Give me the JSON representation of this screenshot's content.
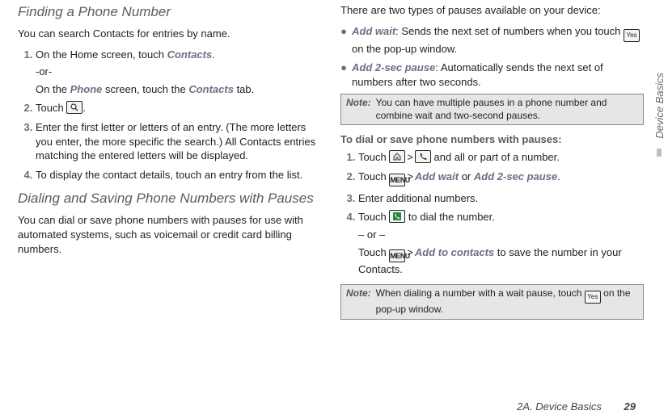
{
  "left": {
    "h_find": "Finding a Phone Number",
    "find_intro": "You can search Contacts for entries by name.",
    "find_steps": [
      {
        "text": "On the Home screen, touch ",
        "bold1": "Contacts",
        "tail": ".",
        "sub1": "-or-",
        "sub2a": "On the ",
        "sub2b": "Phone",
        "sub2c": " screen, touch the ",
        "sub2d": "Contacts",
        "sub2e": " tab."
      },
      {
        "text": "Touch ",
        "icon": "search",
        "tail": "."
      },
      {
        "text": "Enter the first letter or letters of an entry. (The more letters you enter, the more specific the search.) All Contacts entries matching the entered letters will be displayed."
      },
      {
        "text": "To display the contact details, touch an entry from the list."
      }
    ],
    "h_dial": "Dialing and Saving Phone Numbers with Pauses",
    "dial_intro": "You can dial or save phone numbers with pauses for use with automated systems, such as voicemail or credit card billing numbers."
  },
  "right": {
    "pauses_intro": "There are two types of pauses available on your device:",
    "bullets": [
      {
        "b": "Add wait",
        "rest": ": Sends the next set of numbers when you touch ",
        "icon": "yes",
        "tail": " on the pop-up window."
      },
      {
        "b": "Add 2-sec pause",
        "rest": ": Automatically sends the next set of numbers after two seconds."
      }
    ],
    "note1_label": "Note:",
    "note1": "You can have multiple pauses in a phone number and combine wait and two-second pauses.",
    "subhead": "To dial or save phone numbers with pauses:",
    "steps": [
      {
        "pre": "Touch ",
        "icon1": "home",
        "gt": ">",
        "icon2": "phone",
        "post": " and all or part of a number."
      },
      {
        "pre": "Touch ",
        "icon1": "menu",
        "gt": ">",
        "b1": "Add wait",
        "mid": " or ",
        "b2": "Add 2-sec pause",
        "post": "."
      },
      {
        "pre": "Enter additional numbers."
      },
      {
        "pre": "Touch ",
        "icon1": "dial",
        "post": " to dial the number.",
        "or": "– or –",
        "alt_pre": "Touch ",
        "alt_icon": "menu",
        "alt_gt": ">",
        "alt_b": "Add to contacts",
        "alt_post": " to save the number in your Contacts."
      }
    ],
    "note2_label": "Note:",
    "note2a": "When dialing a number with a wait pause, touch ",
    "note2_icon": "yes",
    "note2b": " on the pop-up window."
  },
  "icons": {
    "menu": "MENU",
    "yes": "Yes"
  },
  "side_tab": "Device Basics",
  "footer_section": "2A. Device Basics",
  "footer_page": "29"
}
